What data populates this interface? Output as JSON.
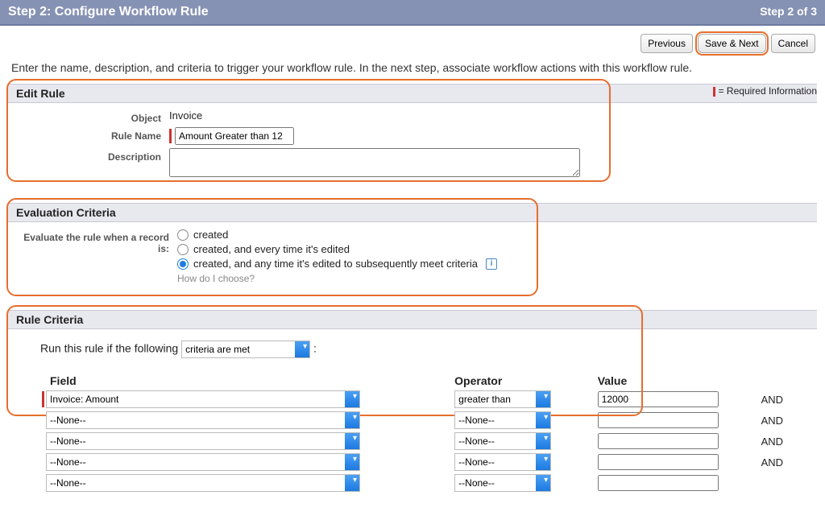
{
  "header": {
    "title": "Step 2: Configure Workflow Rule",
    "step_count": "Step 2 of 3"
  },
  "buttons": {
    "previous": "Previous",
    "save_next": "Save & Next",
    "cancel": "Cancel"
  },
  "intro": "Enter the name, description, and criteria to trigger your workflow rule. In the next step, associate workflow actions with this workflow rule.",
  "required_info_label": "= Required Information",
  "edit_rule": {
    "section_title": "Edit Rule",
    "object_label": "Object",
    "object_value": "Invoice",
    "rule_name_label": "Rule Name",
    "rule_name_value": "Amount Greater than 12",
    "description_label": "Description",
    "description_value": ""
  },
  "eval_criteria": {
    "section_title": "Evaluation Criteria",
    "prompt": "Evaluate the rule when a record is:",
    "options": [
      "created",
      "created, and every time it's edited",
      "created, and any time it's edited to subsequently meet criteria"
    ],
    "selected_index": 2,
    "help_link": "How do I choose?"
  },
  "rule_criteria": {
    "section_title": "Rule Criteria",
    "run_prompt_prefix": "Run this rule if the following",
    "run_option": "criteria are met",
    "run_prompt_suffix": ":",
    "columns": {
      "field": "Field",
      "operator": "Operator",
      "value": "Value"
    },
    "rows": [
      {
        "field": "Invoice: Amount",
        "operator": "greater than",
        "value": "12000",
        "and": "AND",
        "required": true
      },
      {
        "field": "--None--",
        "operator": "--None--",
        "value": "",
        "and": "AND",
        "required": false
      },
      {
        "field": "--None--",
        "operator": "--None--",
        "value": "",
        "and": "AND",
        "required": false
      },
      {
        "field": "--None--",
        "operator": "--None--",
        "value": "",
        "and": "AND",
        "required": false
      },
      {
        "field": "--None--",
        "operator": "--None--",
        "value": "",
        "and": "",
        "required": false
      }
    ]
  }
}
